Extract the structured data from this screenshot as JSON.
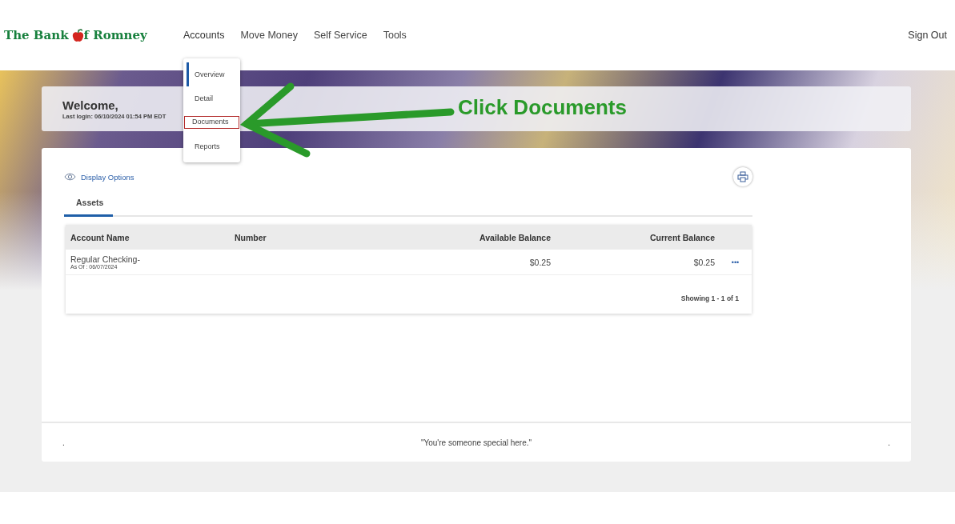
{
  "logo": {
    "before": "The Bank",
    "after": "f Romney"
  },
  "nav": [
    {
      "label": "Accounts",
      "expanded": true
    },
    {
      "label": "Move Money",
      "expanded": false
    },
    {
      "label": "Self Service",
      "expanded": false
    },
    {
      "label": "Tools",
      "expanded": false
    }
  ],
  "sign_out": "Sign Out",
  "accounts_menu": [
    {
      "label": "Overview",
      "selected": true,
      "highlighted": false
    },
    {
      "label": "Detail",
      "selected": false,
      "highlighted": false
    },
    {
      "label": "Documents",
      "selected": false,
      "highlighted": true
    },
    {
      "label": "Reports",
      "selected": false,
      "highlighted": false
    }
  ],
  "welcome": {
    "title": "Welcome,",
    "last_login": "Last login: 06/10/2024 01:54 PM EDT"
  },
  "display_options": "Display Options",
  "tabs": [
    {
      "label": "Assets",
      "selected": true
    }
  ],
  "table": {
    "columns": [
      "Account Name",
      "Number",
      "Available Balance",
      "Current Balance"
    ],
    "rows": [
      {
        "name": "Regular Checking-",
        "as_of": "As Of : 06/07/2024",
        "available": "$0.25",
        "current": "$0.25",
        "more": "•••"
      }
    ],
    "pagination": "Showing 1 - 1 of 1"
  },
  "footer": {
    "left": ".",
    "quote": "\"You're someone special here.\"",
    "right": "."
  },
  "annotation": {
    "text": "Click Documents"
  }
}
